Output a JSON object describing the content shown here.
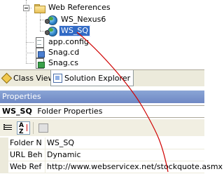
{
  "tree": {
    "items": [
      {
        "label": "Web References",
        "icon": "folder-icon"
      },
      {
        "label": "WS_Nexus6",
        "icon": "web-reference-icon"
      },
      {
        "label": "WS_SQ",
        "icon": "web-reference-icon",
        "selected": true
      },
      {
        "label": "app.config",
        "icon": "document-icon"
      },
      {
        "label": "Snag.cd",
        "icon": "class-diagram-icon"
      },
      {
        "label": "Snag.cs",
        "icon": "cs-file-icon"
      }
    ]
  },
  "tabs": [
    {
      "label": "Class View",
      "icon": "class-view-icon",
      "active": false
    },
    {
      "label": "Solution Explorer",
      "icon": "solution-explorer-icon",
      "active": true
    }
  ],
  "properties": {
    "title": "Properties",
    "object_name": "WS_SQ",
    "object_type": "Folder Properties",
    "toolbar": [
      {
        "name": "categorized",
        "icon": "categorized-icon",
        "pressed": false
      },
      {
        "name": "alphabetical",
        "icon": "alphabetical-icon",
        "pressed": true,
        "glyph": "A Z"
      },
      {
        "name": "property-pages",
        "icon": "property-pages-icon",
        "pressed": false
      }
    ],
    "rows": [
      {
        "name": "Folder Na",
        "value": "WS_SQ"
      },
      {
        "name": "URL Beh",
        "value": "Dynamic"
      },
      {
        "name": "Web Ref",
        "value": "http://www.webservicex.net/stockquote.asmx"
      }
    ]
  },
  "colors": {
    "selection": "#316ac5",
    "annotation": "#d00000",
    "properties_header": "#7a94cc"
  }
}
